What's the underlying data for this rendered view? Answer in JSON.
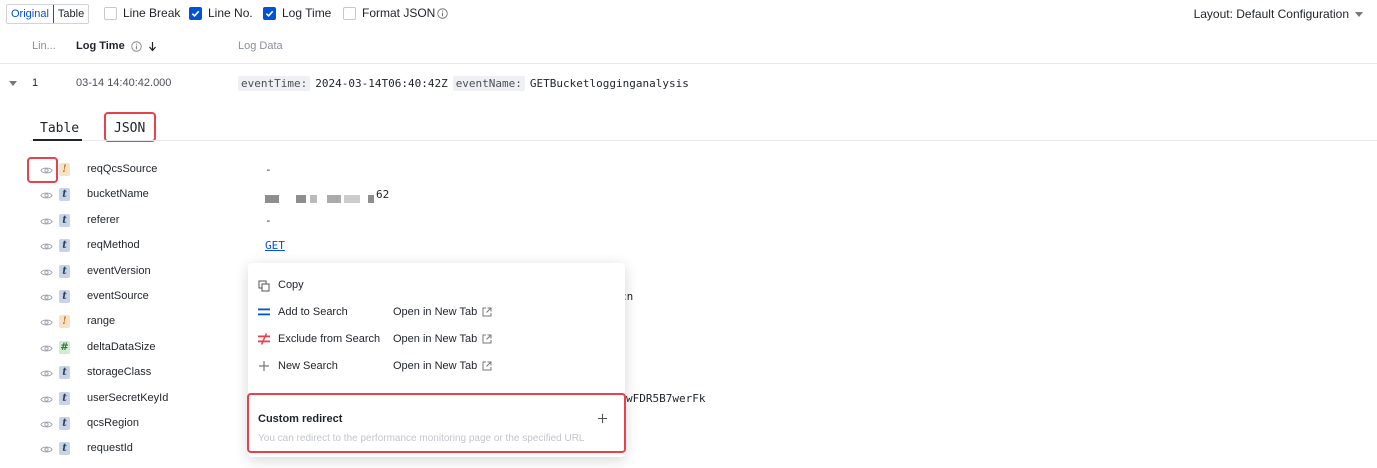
{
  "toolbar": {
    "view_original": "Original",
    "view_table": "Table",
    "line_break": "Line Break",
    "line_no": "Line No.",
    "log_time": "Log Time",
    "format_json": "Format JSON",
    "line_break_checked": false,
    "line_no_checked": true,
    "log_time_checked": true,
    "format_json_checked": false,
    "layout": "Layout: Default Configuration"
  },
  "header": {
    "line": "Lin...",
    "log_time": "Log Time",
    "log_data": "Log Data"
  },
  "row": {
    "line_no": "1",
    "time": "03-14 14:40:42.000",
    "k1": "eventTime:",
    "v1": "2024-03-14T06:40:42Z",
    "k2": "eventName:",
    "v2": "GETBucketlogginganalysis"
  },
  "subtabs": {
    "table": "Table",
    "json": "JSON"
  },
  "fields": [
    {
      "name": "reqQcsSource",
      "type": "!",
      "value": "-"
    },
    {
      "name": "bucketName",
      "type": "t",
      "value": "62"
    },
    {
      "name": "referer",
      "type": "t",
      "value": "-"
    },
    {
      "name": "reqMethod",
      "type": "t",
      "value": "GET"
    },
    {
      "name": "eventVersion",
      "type": "t",
      "value": ""
    },
    {
      "name": "eventSource",
      "type": "t",
      "value": "cn"
    },
    {
      "name": "range",
      "type": "!",
      "value": ""
    },
    {
      "name": "deltaDataSize",
      "type": "#",
      "value": ""
    },
    {
      "name": "storageClass",
      "type": "t",
      "value": ""
    },
    {
      "name": "userSecretKeyId",
      "type": "t",
      "value": "wFDR5B7werFk"
    },
    {
      "name": "qcsRegion",
      "type": "t",
      "value": ""
    },
    {
      "name": "requestId",
      "type": "t",
      "value": ""
    }
  ],
  "menu": {
    "copy": "Copy",
    "add_to_search": "Add to Search",
    "exclude_from_search": "Exclude from Search",
    "new_search": "New Search",
    "open_new_tab": "Open in New Tab",
    "custom_redirect": "Custom redirect",
    "custom_redirect_hint": "You can redirect to the performance monitoring page or the specified URL"
  },
  "colors": {
    "accent": "#0052d9",
    "highlight": "#e8414c"
  }
}
